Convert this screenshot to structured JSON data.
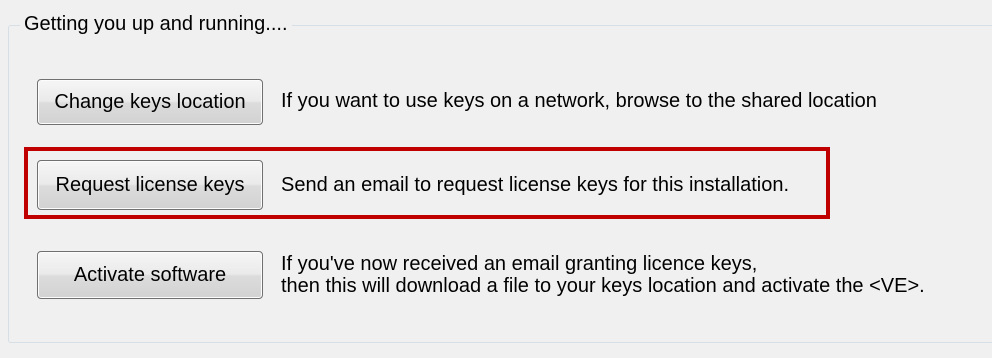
{
  "group": {
    "title": "Getting you up and running...."
  },
  "rows": [
    {
      "button_label": "Change keys location",
      "description": "If you want to use keys on a network, browse to the shared location"
    },
    {
      "button_label": "Request license keys",
      "description": "Send an email to request license keys for this installation."
    },
    {
      "button_label": "Activate software",
      "description_lines": [
        "If you've now received an email granting licence keys,",
        "then this will download a file to your keys location and activate the <VE>."
      ]
    }
  ],
  "colors": {
    "highlight": "#c00000",
    "background": "#f0f0f0",
    "group_border": "#d5dfe5"
  }
}
